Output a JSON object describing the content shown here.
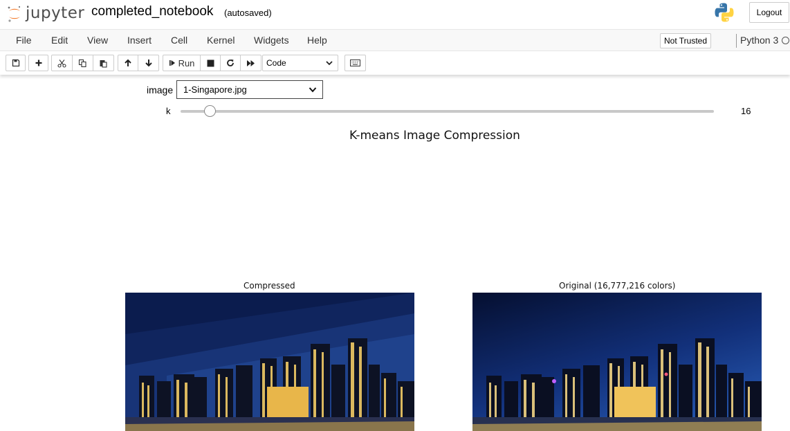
{
  "header": {
    "logo_text": "jupyter",
    "notebook_name": "completed_notebook",
    "save_status": "(autosaved)",
    "logout_label": "Logout",
    "python_logo": "python-logo-icon"
  },
  "menubar": {
    "items": [
      "File",
      "Edit",
      "View",
      "Insert",
      "Cell",
      "Kernel",
      "Widgets",
      "Help"
    ],
    "trust_label": "Not Trusted",
    "kernel_name": "Python 3"
  },
  "toolbar": {
    "icons": [
      "save-icon",
      "plus-icon",
      "cut-icon",
      "copy-icon",
      "paste-icon",
      "arrow-up-icon",
      "arrow-down-icon",
      "step-forward-icon",
      "stop-icon",
      "restart-icon",
      "fast-forward-icon",
      "keyboard-icon"
    ],
    "run_label": "Run",
    "cell_type": "Code"
  },
  "widgets": {
    "image_label": "image",
    "image_value": "1-Singapore.jpg",
    "k_label": "k",
    "k_value": "16",
    "k_min": 2,
    "k_max": 256
  },
  "figure": {
    "title": "K-means Image Compression",
    "left_title": "Compressed",
    "right_title": "Original (16,777,216 colors)"
  },
  "colors": {
    "jupyter_orange": "#f37726",
    "menubar_bg": "#f8f8f8",
    "border": "#cccccc",
    "night_sky_top": "#061236",
    "night_sky_bottom": "#1c3f8f"
  }
}
